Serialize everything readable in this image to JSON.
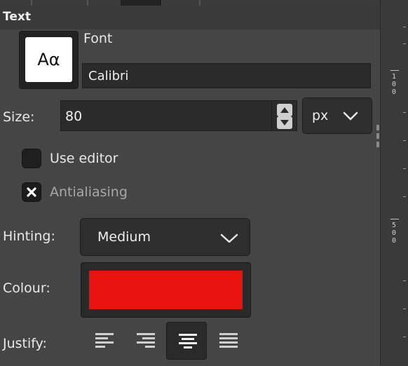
{
  "header": {
    "title": "Text"
  },
  "font": {
    "preview_glyph": "Aα",
    "label": "Font",
    "value": "Calibri"
  },
  "size": {
    "label": "Size:",
    "value": "80",
    "unit": "px"
  },
  "options": {
    "use_editor": {
      "label": "Use editor",
      "checked": false
    },
    "antialiasing": {
      "label": "Antialiasing",
      "checked": true
    }
  },
  "hinting": {
    "label": "Hinting:",
    "value": "Medium"
  },
  "colour": {
    "label": "Colour:",
    "value": "#e8120f"
  },
  "justify": {
    "label": "Justify:",
    "options": [
      "left",
      "right",
      "center",
      "fill"
    ],
    "active": "center"
  },
  "ruler": {
    "labels": [
      "100",
      "500"
    ]
  }
}
